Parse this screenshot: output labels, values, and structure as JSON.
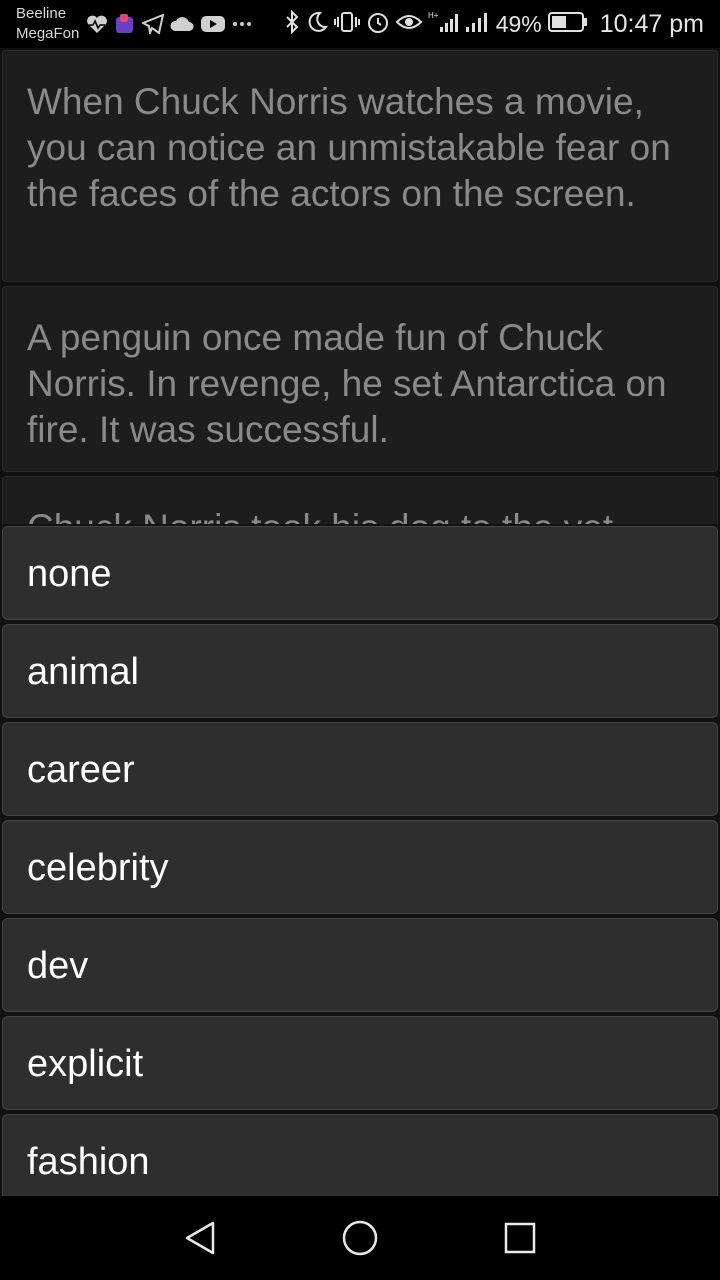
{
  "status_bar": {
    "carrier_1": "Beeline",
    "carrier_2": "MegaFon",
    "network_type": "H+",
    "battery_percent": "49%",
    "time": "10:47 pm",
    "icons": [
      "heart-pulse-icon",
      "app-icon",
      "telegram-icon",
      "cloud-icon",
      "youtube-icon",
      "more-icon",
      "bluetooth-icon",
      "moon-icon",
      "vibrate-icon",
      "alarm-icon",
      "eye-icon",
      "signal-icon",
      "battery-icon"
    ]
  },
  "jokes": [
    {
      "text": "When Chuck Norris watches a movie, you can notice an unmistakable fear on the faces of the actors on the screen."
    },
    {
      "text": "A penguin once made fun of Chuck Norris. In revenge, he set Antarctica on fire. It was successful."
    },
    {
      "text": "Chuck Norris took his dog to the vet"
    }
  ],
  "category_menu": {
    "items": [
      {
        "label": "none"
      },
      {
        "label": "animal"
      },
      {
        "label": "career"
      },
      {
        "label": "celebrity"
      },
      {
        "label": "dev"
      },
      {
        "label": "explicit"
      },
      {
        "label": "fashion"
      }
    ]
  },
  "colors": {
    "background": "#1a1a1a",
    "card": "#1d1d1d",
    "menu_item": "#2e2e2e",
    "menu_text": "#ffffff",
    "joke_text": "#8a8a8a"
  }
}
